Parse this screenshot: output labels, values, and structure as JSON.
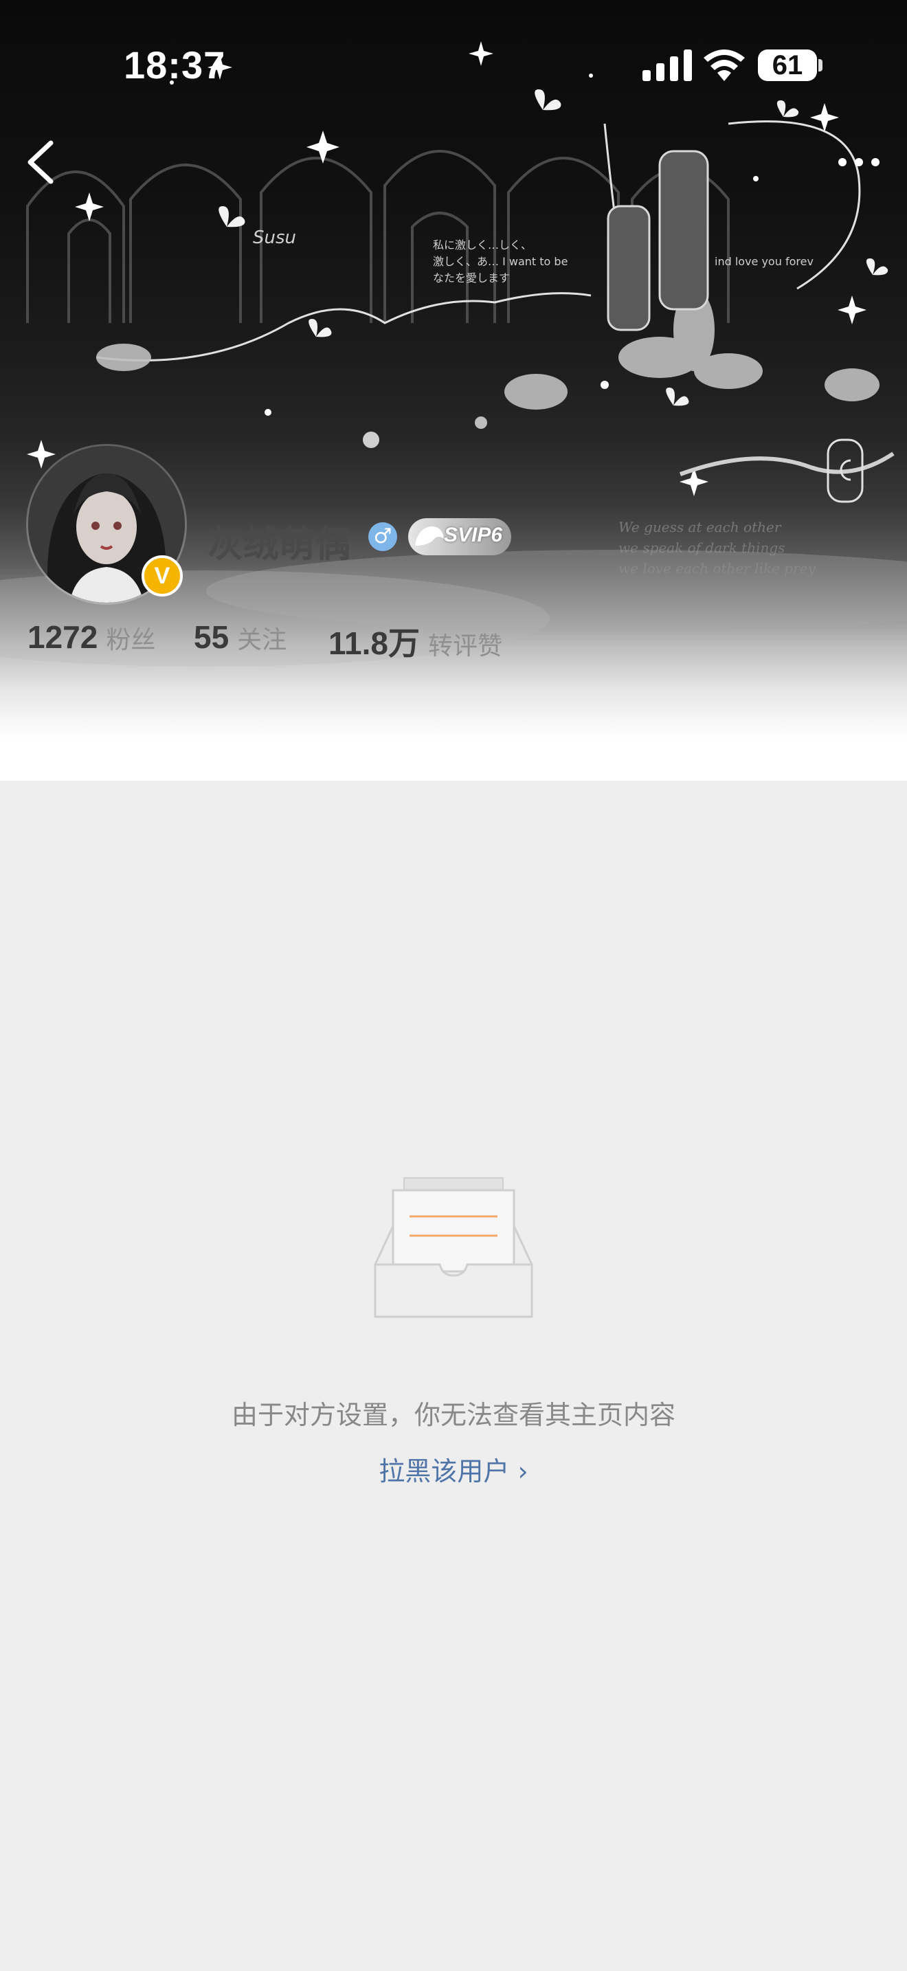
{
  "status_bar": {
    "time": "18:37",
    "battery": "61"
  },
  "profile": {
    "username": "灰绒萌偶",
    "gender_symbol": "♂",
    "vip_label": "SVIP6",
    "verified_badge": "V",
    "stats": [
      {
        "number": "1272",
        "label": "粉丝"
      },
      {
        "number": "55",
        "label": "关注"
      },
      {
        "number": "11.8万",
        "label": "转评赞"
      }
    ]
  },
  "cover": {
    "signature": "Susu",
    "japanese_lines": [
      "私に激しく…しく、",
      "激しく、あ… I want to be",
      "なたを愛します"
    ],
    "english_right": "ind love you forev",
    "script_lines": [
      "We guess at each other",
      "we speak of dark things",
      "we love each other like prey"
    ]
  },
  "restricted": {
    "message": "由于对方设置，你无法查看其主页内容",
    "block_link": "拉黑该用户 ›"
  },
  "colors": {
    "link": "#4f74a8",
    "vip_gold": "#f5b400",
    "gender_blue": "#7fb6ea"
  }
}
